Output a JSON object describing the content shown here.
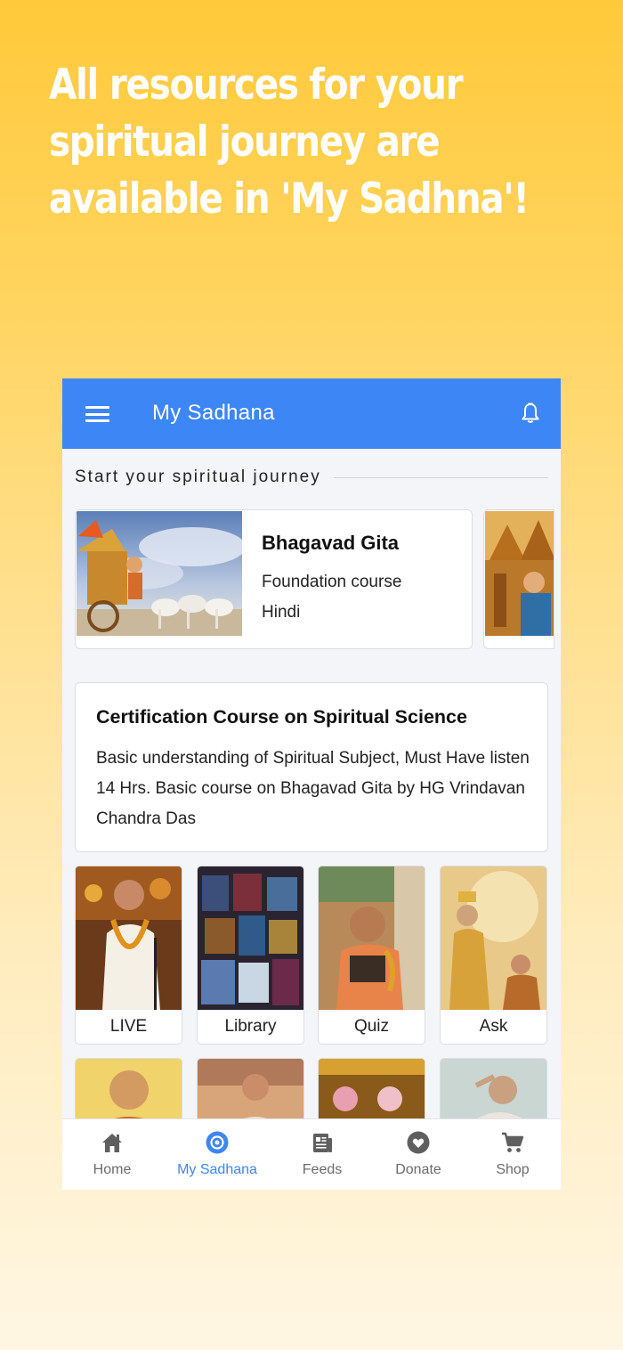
{
  "promo": {
    "headline": "All resources for your spiritual journey are available in 'My Sadhna'!"
  },
  "appbar": {
    "title": "My Sadhana",
    "menu_icon": "hamburger-menu-icon",
    "bell_icon": "notification-bell-icon",
    "color": "#3d86f6"
  },
  "section": {
    "title": "Start your spiritual journey"
  },
  "courses": [
    {
      "title": "Bhagavad Gita",
      "subtitle": "Foundation course",
      "language": "Hindi"
    }
  ],
  "certification": {
    "title": "Certification Course on Spiritual Science",
    "description": "Basic understanding of Spiritual Subject, Must Have listen 14 Hrs. Basic course on Bhagavad Gita by HG Vrindavan Chandra Das"
  },
  "tiles": [
    {
      "label": "LIVE"
    },
    {
      "label": "Library"
    },
    {
      "label": "Quiz"
    },
    {
      "label": "Ask"
    }
  ],
  "bottom_nav": {
    "items": [
      {
        "label": "Home",
        "icon": "home-icon"
      },
      {
        "label": "My Sadhana",
        "icon": "target-circle-icon",
        "active": true
      },
      {
        "label": "Feeds",
        "icon": "newspaper-icon"
      },
      {
        "label": "Donate",
        "icon": "heart-circle-icon"
      },
      {
        "label": "Shop",
        "icon": "cart-icon"
      }
    ],
    "active_color": "#3d86f6",
    "inactive_color": "#6b6b6b"
  }
}
